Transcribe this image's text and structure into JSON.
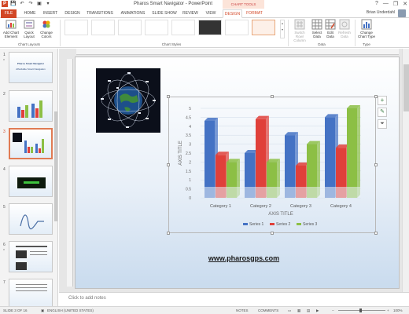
{
  "window": {
    "title": "Pharos Smart Navigator - PowerPoint",
    "contextual_label": "CHART TOOLS",
    "controls": [
      "?",
      "—",
      "❐",
      "✕"
    ]
  },
  "tabs": [
    "FILE",
    "HOME",
    "INSERT",
    "DESIGN",
    "TRANSITIONS",
    "ANIMATIONS",
    "SLIDE SHOW",
    "REVIEW",
    "VIEW",
    "DESIGN",
    "FORMAT"
  ],
  "user": {
    "name": "Brian Underdahl"
  },
  "ribbon": {
    "add_chart_element": "Add Chart Element",
    "quick_layout": "Quick Layout",
    "change_colors": "Change Colors",
    "chart_layouts_label": "Chart Layouts",
    "chart_styles_label": "Chart Styles",
    "switch_row_column": "Switch Row/ Column",
    "select_data": "Select Data",
    "edit_data": "Edit Data",
    "refresh_data": "Refresh Data",
    "data_label": "Data",
    "change_chart_type": "Change Chart Type",
    "type_label": "Type"
  },
  "thumbnails": [
    {
      "num": "1",
      "title": "Pharos Smart Navigator",
      "subtitle": "Affordable Smart Navigation",
      "star": "*"
    },
    {
      "num": "2"
    },
    {
      "num": "3"
    },
    {
      "num": "4"
    },
    {
      "num": "5"
    },
    {
      "num": "6",
      "star": "*"
    },
    {
      "num": "7"
    }
  ],
  "slide": {
    "url": "www.pharosgps.com"
  },
  "chart_data": {
    "type": "bar",
    "categories": [
      "Category 1",
      "Category 2",
      "Category 3",
      "Category 4"
    ],
    "series": [
      {
        "name": "Series 1",
        "values": [
          4.3,
          2.5,
          3.5,
          4.5
        ],
        "color": "#4472c4"
      },
      {
        "name": "Series 2",
        "values": [
          2.4,
          4.4,
          1.8,
          2.8
        ],
        "color": "#e0403a"
      },
      {
        "name": "Series 3",
        "values": [
          2.0,
          2.0,
          3.0,
          5.0
        ],
        "color": "#8cbf45"
      }
    ],
    "ylim": [
      0,
      5
    ],
    "yticks": [
      "0",
      "0.5",
      "1",
      "1.5",
      "2",
      "2.5",
      "3",
      "3.5",
      "4",
      "4.5",
      "5"
    ],
    "xlabel": "AXIS TITLE",
    "ylabel": "AXIS TITLE",
    "legend": "bottom"
  },
  "notes": {
    "placeholder": "Click to add notes"
  },
  "status": {
    "slide": "SLIDE 3 OF 16",
    "language": "ENGLISH (UNITED STATES)",
    "notes": "NOTES",
    "comments": "COMMENTS",
    "zoom": "100%"
  },
  "colors": {
    "accent": "#d24726",
    "selection": "#e07b54"
  }
}
